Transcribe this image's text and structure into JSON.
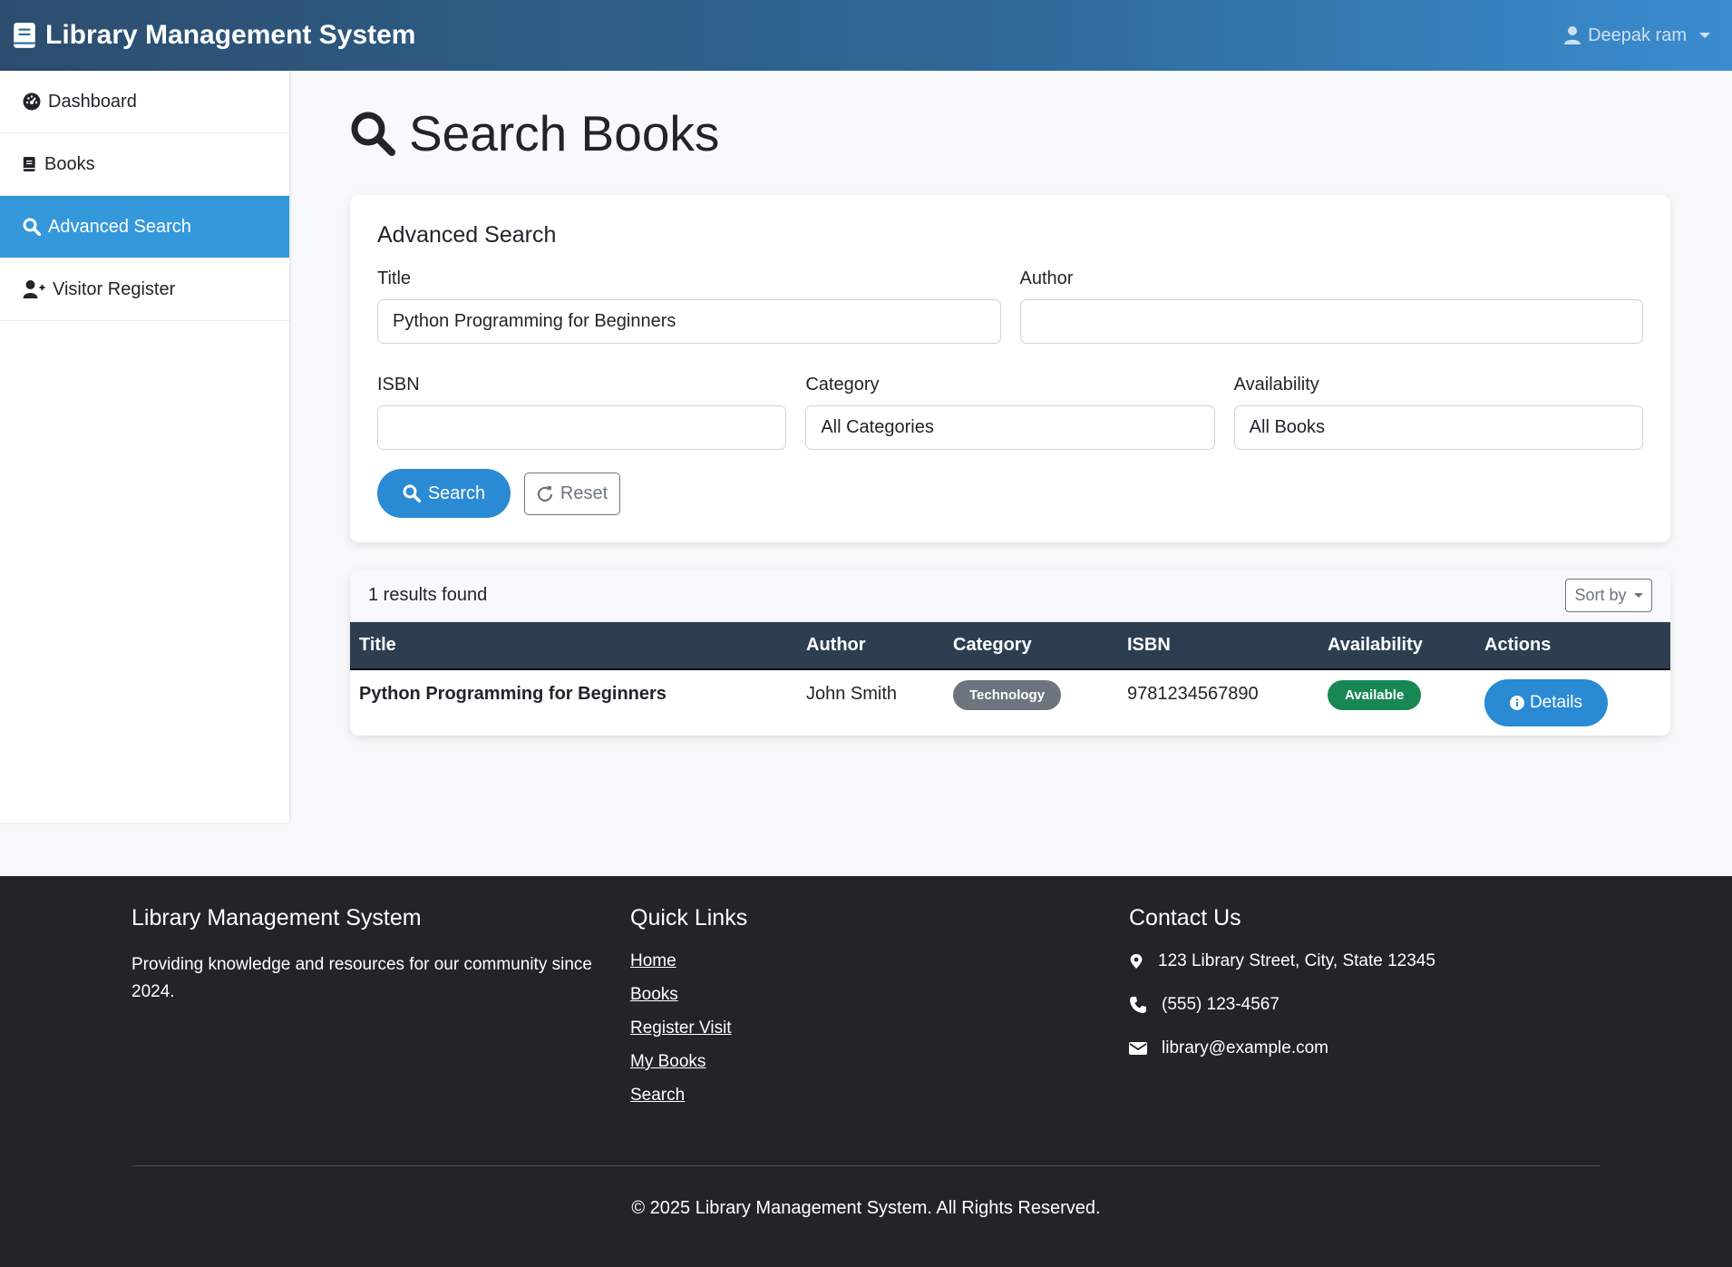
{
  "navbar": {
    "brand": "Library Management System",
    "brand_icon": "book-icon",
    "user_name": "Deepak ram",
    "user_icon": "user-icon"
  },
  "sidebar": {
    "items": [
      {
        "label": "Dashboard",
        "icon": "dashboard-icon",
        "active": false
      },
      {
        "label": "Books",
        "icon": "book-icon",
        "active": false
      },
      {
        "label": "Advanced Search",
        "icon": "search-icon",
        "active": true
      },
      {
        "label": "Visitor Register",
        "icon": "user-plus-icon",
        "active": false
      }
    ]
  },
  "page": {
    "title": "Search Books",
    "title_icon": "search-icon"
  },
  "search_form": {
    "heading": "Advanced Search",
    "title_label": "Title",
    "title_value": "Python Programming for Beginners",
    "author_label": "Author",
    "author_value": "",
    "isbn_label": "ISBN",
    "isbn_value": "",
    "category_label": "Category",
    "category_value": "All Categories",
    "availability_label": "Availability",
    "availability_value": "All Books",
    "search_button": "Search",
    "reset_button": "Reset"
  },
  "results": {
    "count_text": "1 results found",
    "sort_label": "Sort by",
    "columns": [
      "Title",
      "Author",
      "Category",
      "ISBN",
      "Availability",
      "Actions"
    ],
    "rows": [
      {
        "title": "Python Programming for Beginners",
        "author": "John Smith",
        "category": "Technology",
        "isbn": "9781234567890",
        "availability": "Available",
        "action": "Details"
      }
    ]
  },
  "footer": {
    "about_heading": "Library Management System",
    "about_text": "Providing knowledge and resources for our community since 2024.",
    "links_heading": "Quick Links",
    "links": [
      "Home",
      "Books",
      "Register Visit",
      "My Books",
      "Search"
    ],
    "contact_heading": "Contact Us",
    "address": "123 Library Street, City, State 12345",
    "phone": "(555) 123-4567",
    "email": "library@example.com",
    "copyright": "© 2025 Library Management System. All Rights Reserved."
  },
  "colors": {
    "primary": "#3498db",
    "button_primary": "#2a8ad4",
    "table_header": "#2c3e50",
    "success": "#198754",
    "secondary": "#6c757d",
    "footer_bg": "#212529"
  }
}
